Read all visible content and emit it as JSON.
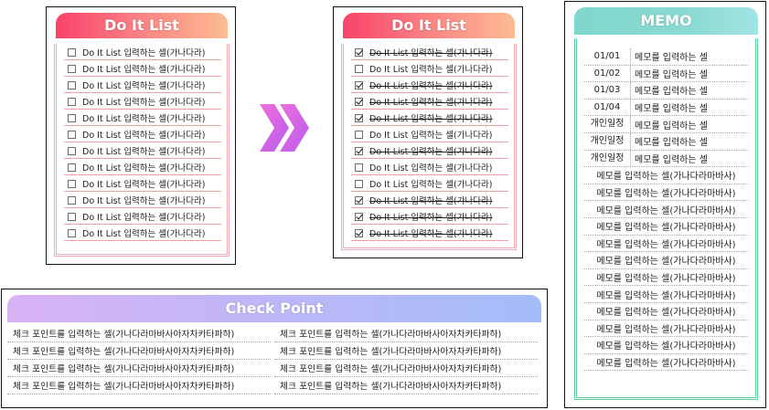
{
  "todo_left": {
    "title": "Do It List",
    "items": [
      {
        "text": "Do It List 입력하는 셀(가나다라)",
        "checked": false
      },
      {
        "text": "Do It List 입력하는 셀(가나다라)",
        "checked": false
      },
      {
        "text": "Do It List 입력하는 셀(가나다라)",
        "checked": false
      },
      {
        "text": "Do It List 입력하는 셀(가나다라)",
        "checked": false
      },
      {
        "text": "Do It List 입력하는 셀(가나다라)",
        "checked": false
      },
      {
        "text": "Do It List 입력하는 셀(가나다라)",
        "checked": false
      },
      {
        "text": "Do It List 입력하는 셀(가나다라)",
        "checked": false
      },
      {
        "text": "Do It List 입력하는 셀(가나다라)",
        "checked": false
      },
      {
        "text": "Do It List 입력하는 셀(가나다라)",
        "checked": false
      },
      {
        "text": "Do It List 입력하는 셀(가나다라)",
        "checked": false
      },
      {
        "text": "Do It List 입력하는 셀(가나다라)",
        "checked": false
      },
      {
        "text": "Do It List 입력하는 셀(가나다라)",
        "checked": false
      }
    ]
  },
  "todo_right": {
    "title": "Do It List",
    "items": [
      {
        "text": "Do It List 입력하는 셀(가나다라)",
        "checked": true
      },
      {
        "text": "Do It List 입력하는 셀(가나다라)",
        "checked": false
      },
      {
        "text": "Do It List 입력하는 셀(가나다라)",
        "checked": true
      },
      {
        "text": "Do It List 입력하는 셀(가나다라)",
        "checked": true
      },
      {
        "text": "Do It List 입력하는 셀(가나다라)",
        "checked": true
      },
      {
        "text": "Do It List 입력하는 셀(가나다라)",
        "checked": false
      },
      {
        "text": "Do It List 입력하는 셀(가나다라)",
        "checked": true
      },
      {
        "text": "Do It List 입력하는 셀(가나다라)",
        "checked": false
      },
      {
        "text": "Do It List 입력하는 셀(가나다라)",
        "checked": false
      },
      {
        "text": "Do It List 입력하는 셀(가나다라)",
        "checked": true
      },
      {
        "text": "Do It List 입력하는 셀(가나다라)",
        "checked": true
      },
      {
        "text": "Do It List 입력하는 셀(가나다라)",
        "checked": true
      }
    ]
  },
  "arrow": {
    "icon": "double-chevron-right-icon",
    "colors": [
      "#f06fd8",
      "#b65cf2"
    ]
  },
  "memo": {
    "title": "MEMO",
    "dated_rows": [
      {
        "date": "01/01",
        "note": "메모를 입력하는 셀"
      },
      {
        "date": "01/02",
        "note": "메모를 입력하는 셀"
      },
      {
        "date": "01/03",
        "note": "메모를 입력하는 셀"
      },
      {
        "date": "01/04",
        "note": "메모를 입력하는 셀"
      },
      {
        "date": "개인일정",
        "note": "메모를 입력하는 셀"
      },
      {
        "date": "개인일정",
        "note": "메모를 입력하는 셀"
      },
      {
        "date": "개인일정",
        "note": "메모를 입력하는 셀"
      }
    ],
    "free_rows": [
      "메모를 입력하는 셀(가나다라마바사)",
      "메모를 입력하는 셀(가나다라마바사)",
      "메모를 입력하는 셀(가나다라마바사)",
      "메모를 입력하는 셀(가나다라마바사)",
      "메모를 입력하는 셀(가나다라마바사)",
      "메모를 입력하는 셀(가나다라마바사)",
      "메모를 입력하는 셀(가나다라마바사)",
      "메모를 입력하는 셀(가나다라마바사)",
      "메모를 입력하는 셀(가나다라마바사)",
      "메모를 입력하는 셀(가나다라마바사)",
      "메모를 입력하는 셀(가나다라마바사)",
      "메모를 입력하는 셀(가나다라마바사)"
    ]
  },
  "check_point": {
    "title": "Check Point",
    "left": [
      "체크 포인트를 입력하는 셀(가나다라마바사아자차카타파하)",
      "체크 포인트를 입력하는 셀(가나다라마바사아자차카타파하)",
      "체크 포인트를 입력하는 셀(가나다라마바사아자차카타파하)",
      "체크 포인트를 입력하는 셀(가나다라마바사아자차카타파하)"
    ],
    "right": [
      "체크 포인트를 입력하는 셀(가나다라마바사아자차카타파하)",
      "체크 포인트를 입력하는 셀(가나다라마바사아자차카타파하)",
      "체크 포인트를 입력하는 셀(가나다라마바사아자차카타파하)",
      "체크 포인트를 입력하는 셀(가나다라마바사아자차카타파하)"
    ]
  }
}
